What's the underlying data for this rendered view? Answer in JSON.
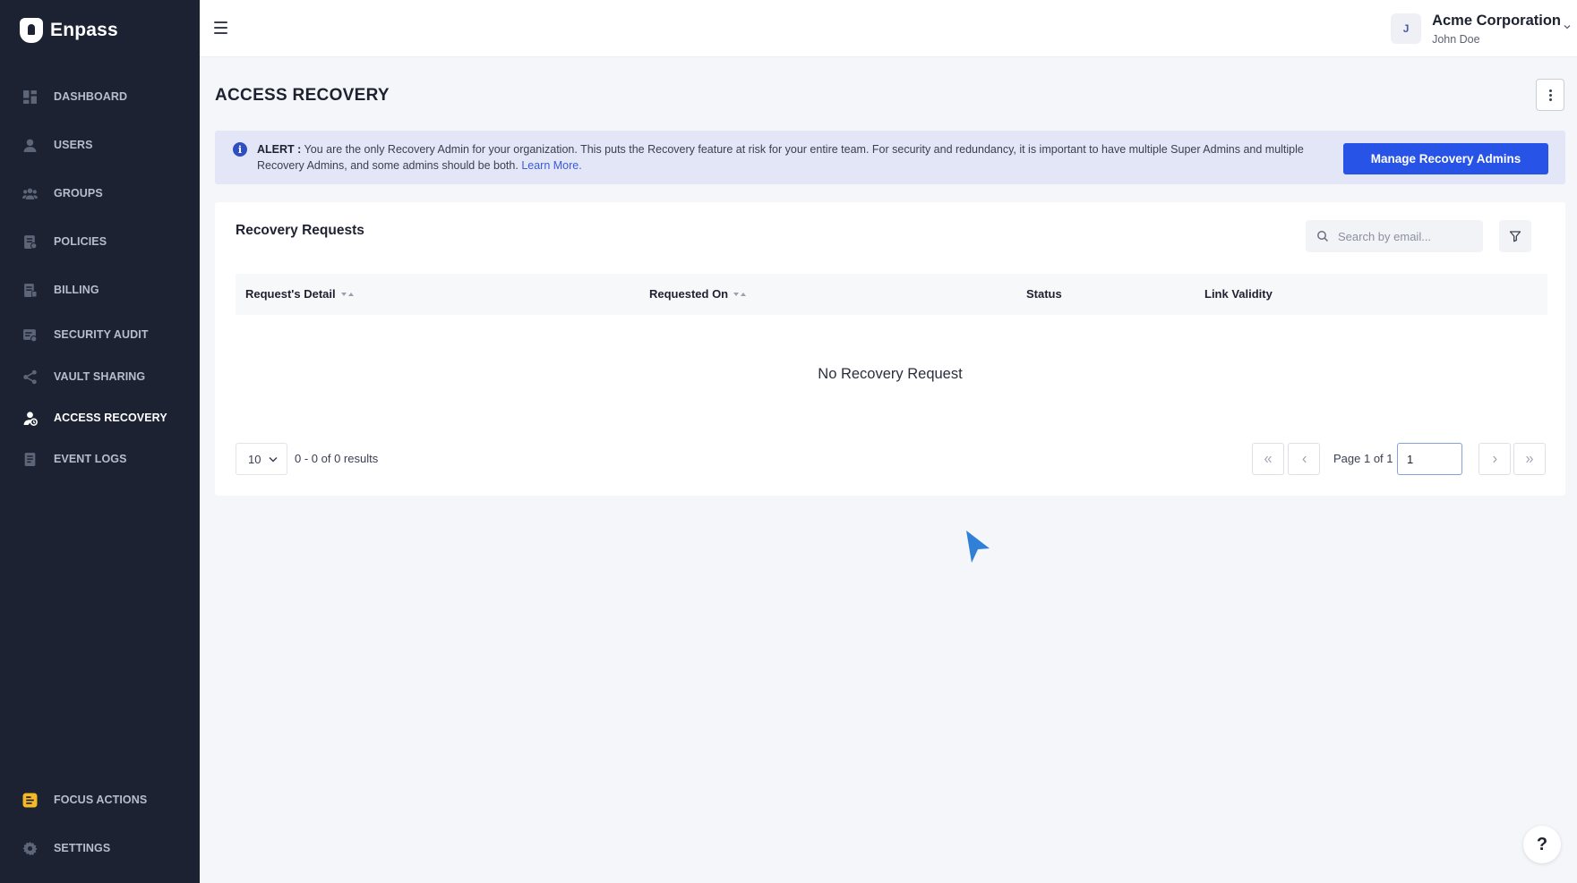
{
  "brand": {
    "name": "Enpass"
  },
  "sidebar": {
    "items": [
      {
        "label": "DASHBOARD",
        "icon": "dashboard-icon"
      },
      {
        "label": "USERS",
        "icon": "user-icon"
      },
      {
        "label": "GROUPS",
        "icon": "groups-icon"
      },
      {
        "label": "POLICIES",
        "icon": "policies-icon"
      },
      {
        "label": "BILLING",
        "icon": "billing-icon"
      },
      {
        "label": "SECURITY AUDIT",
        "icon": "security-audit-icon"
      },
      {
        "label": "VAULT SHARING",
        "icon": "share-icon"
      },
      {
        "label": "ACCESS RECOVERY",
        "icon": "access-recovery-icon",
        "active": true
      },
      {
        "label": "EVENT LOGS",
        "icon": "event-logs-icon"
      }
    ],
    "bottom_items": [
      {
        "label": "FOCUS ACTIONS",
        "icon": "focus-actions-icon"
      },
      {
        "label": "SETTINGS",
        "icon": "gear-icon"
      }
    ]
  },
  "header": {
    "avatar_initial": "J",
    "org_name": "Acme Corporation",
    "user_name": "John Doe"
  },
  "page": {
    "title": "ACCESS RECOVERY"
  },
  "alert": {
    "prefix": "ALERT :",
    "message": " You are the only Recovery Admin for your organization. This puts the Recovery feature at risk for your entire team. For security and redundancy, it is important to have multiple Super Admins and multiple Recovery Admins, and some admins should be both. ",
    "link_label": "Learn More.",
    "button_label": "Manage Recovery Admins"
  },
  "recovery_requests": {
    "title": "Recovery Requests",
    "search_placeholder": "Search by email...",
    "columns": [
      {
        "label": "Request's Detail",
        "sortable": true
      },
      {
        "label": "Requested On",
        "sortable": true
      },
      {
        "label": "Status",
        "sortable": false
      },
      {
        "label": "Link Validity",
        "sortable": false
      }
    ],
    "empty_message": "No Recovery Request"
  },
  "pagination": {
    "page_size": "10",
    "results_text": "0 - 0 of 0 results",
    "page_label": "Page 1 of 1",
    "current_page": "1"
  },
  "help": {
    "label": "?"
  },
  "colors": {
    "sidebar_bg": "#1c2232",
    "primary": "#2753e6",
    "alert_bg": "#e2e6f6",
    "focus_actions_icon": "#f5b928"
  }
}
